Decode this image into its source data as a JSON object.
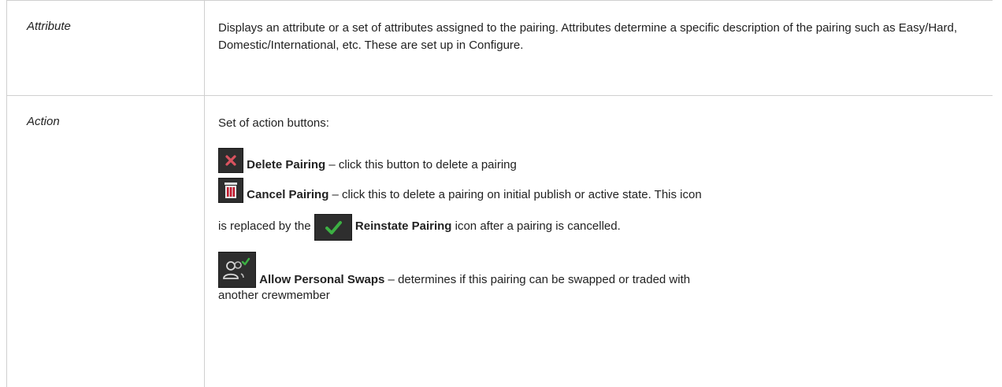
{
  "rows": [
    {
      "term": "Attribute",
      "description": "Displays an attribute or a set of attributes assigned to the pairing. Attributes determine a specific description of the pairing such as Easy/Hard, Domestic/International, etc. These are set up in Configure."
    },
    {
      "term": "Action",
      "intro": "Set of action buttons:",
      "items": {
        "delete": {
          "label": "Delete Pairing",
          "text": " – click this button to delete a pairing"
        },
        "cancel": {
          "label": "Cancel Pairing",
          "text": " – click this to delete a pairing on initial publish or active state. This icon"
        },
        "reinstate_pre": "is replaced by the ",
        "reinstate": {
          "label": "Reinstate Pairing",
          "text": " icon after a pairing is cancelled."
        },
        "swaps": {
          "label": "Allow Personal Swaps",
          "text": " – determines if this pairing can be swapped or traded with"
        },
        "swaps_cont": "another crewmember"
      }
    }
  ],
  "colors": {
    "icon_bg": "#2e2e2e",
    "delete_x": "#d9535f",
    "trash": "#c0152a",
    "check": "#3cb043"
  }
}
